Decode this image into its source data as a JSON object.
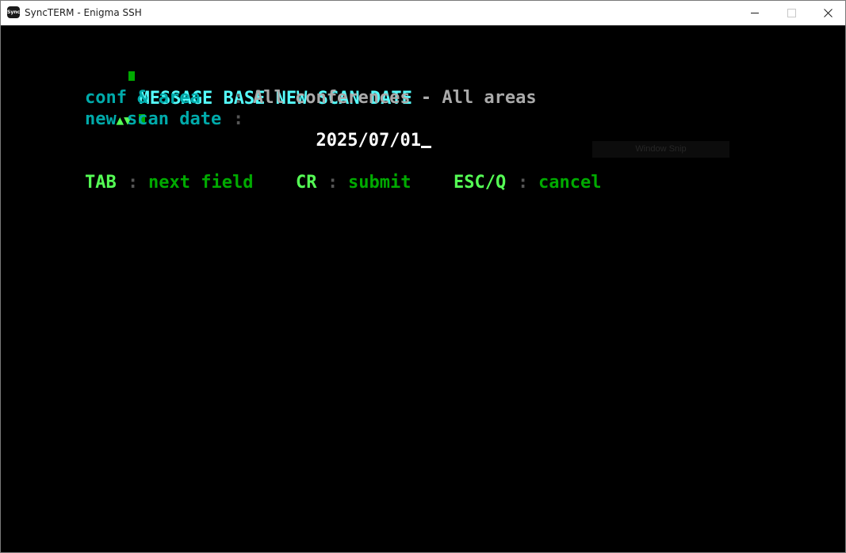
{
  "window": {
    "title": "SyncTERM - Enigma SSH",
    "icon_label": "Sync",
    "icon": "syncterm-app-icon"
  },
  "controls": {
    "minimize_icon": "minimize-icon",
    "maximize_icon": "maximize-icon",
    "close_icon": "close-icon"
  },
  "screen": {
    "heading": "MESSAGE BASE NEW SCAN DATE",
    "selector_arrows": "▲▼",
    "fields": [
      {
        "label": "conf & area",
        "separator": ":",
        "value": "All conferences - All areas"
      },
      {
        "label": "new scan date",
        "separator": ":",
        "value": "2025/07/01"
      }
    ],
    "help": {
      "tab_key": "TAB",
      "tab_action": "next field",
      "cr_key": "CR",
      "cr_action": "submit",
      "esc_key": "ESC/Q",
      "esc_action": "cancel",
      "separator": ":"
    }
  },
  "tooltip": {
    "text": "Window Snip"
  },
  "colors": {
    "bright_cyan": "#55ffff",
    "cyan": "#00aaaa",
    "green": "#00aa00",
    "bright_green": "#55ff55",
    "gray": "#aaaaaa",
    "white": "#ffffff",
    "background": "#000000"
  }
}
